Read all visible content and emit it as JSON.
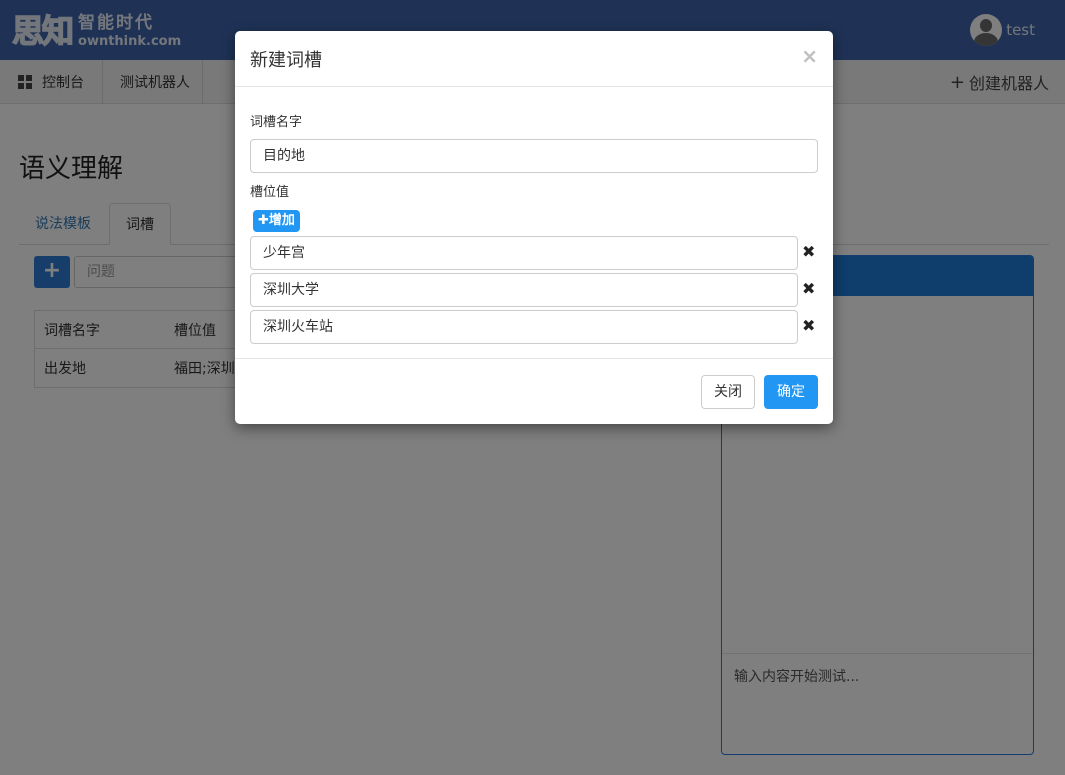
{
  "header": {
    "logo_mark": "思知",
    "logo_cn": "智能时代",
    "logo_en": "ownthink.com",
    "username": "test"
  },
  "nav": {
    "dashboard": "控制台",
    "current_bot": "测试机器人",
    "create_bot": "创建机器人"
  },
  "page": {
    "title": "语义理解",
    "tabs": [
      {
        "label": "说法模板"
      },
      {
        "label": "词槽"
      }
    ],
    "search_placeholder": "问题",
    "table": {
      "headers": [
        "词槽名字",
        "槽位值"
      ],
      "rows": [
        [
          "出发地",
          "福田;深圳"
        ]
      ]
    },
    "test_panel": {
      "input_placeholder": "输入内容开始测试..."
    }
  },
  "modal": {
    "title": "新建词槽",
    "name_label": "词槽名字",
    "name_value": "目的地",
    "values_label": "槽位值",
    "add_value_label": "增加",
    "values": [
      "少年宫",
      "深圳大学",
      "深圳火车站"
    ],
    "close_label": "关闭",
    "confirm_label": "确定"
  },
  "colors": {
    "header_bg": "#3f64ad",
    "primary": "#2196f3",
    "panel_header": "#1e7ddb"
  }
}
